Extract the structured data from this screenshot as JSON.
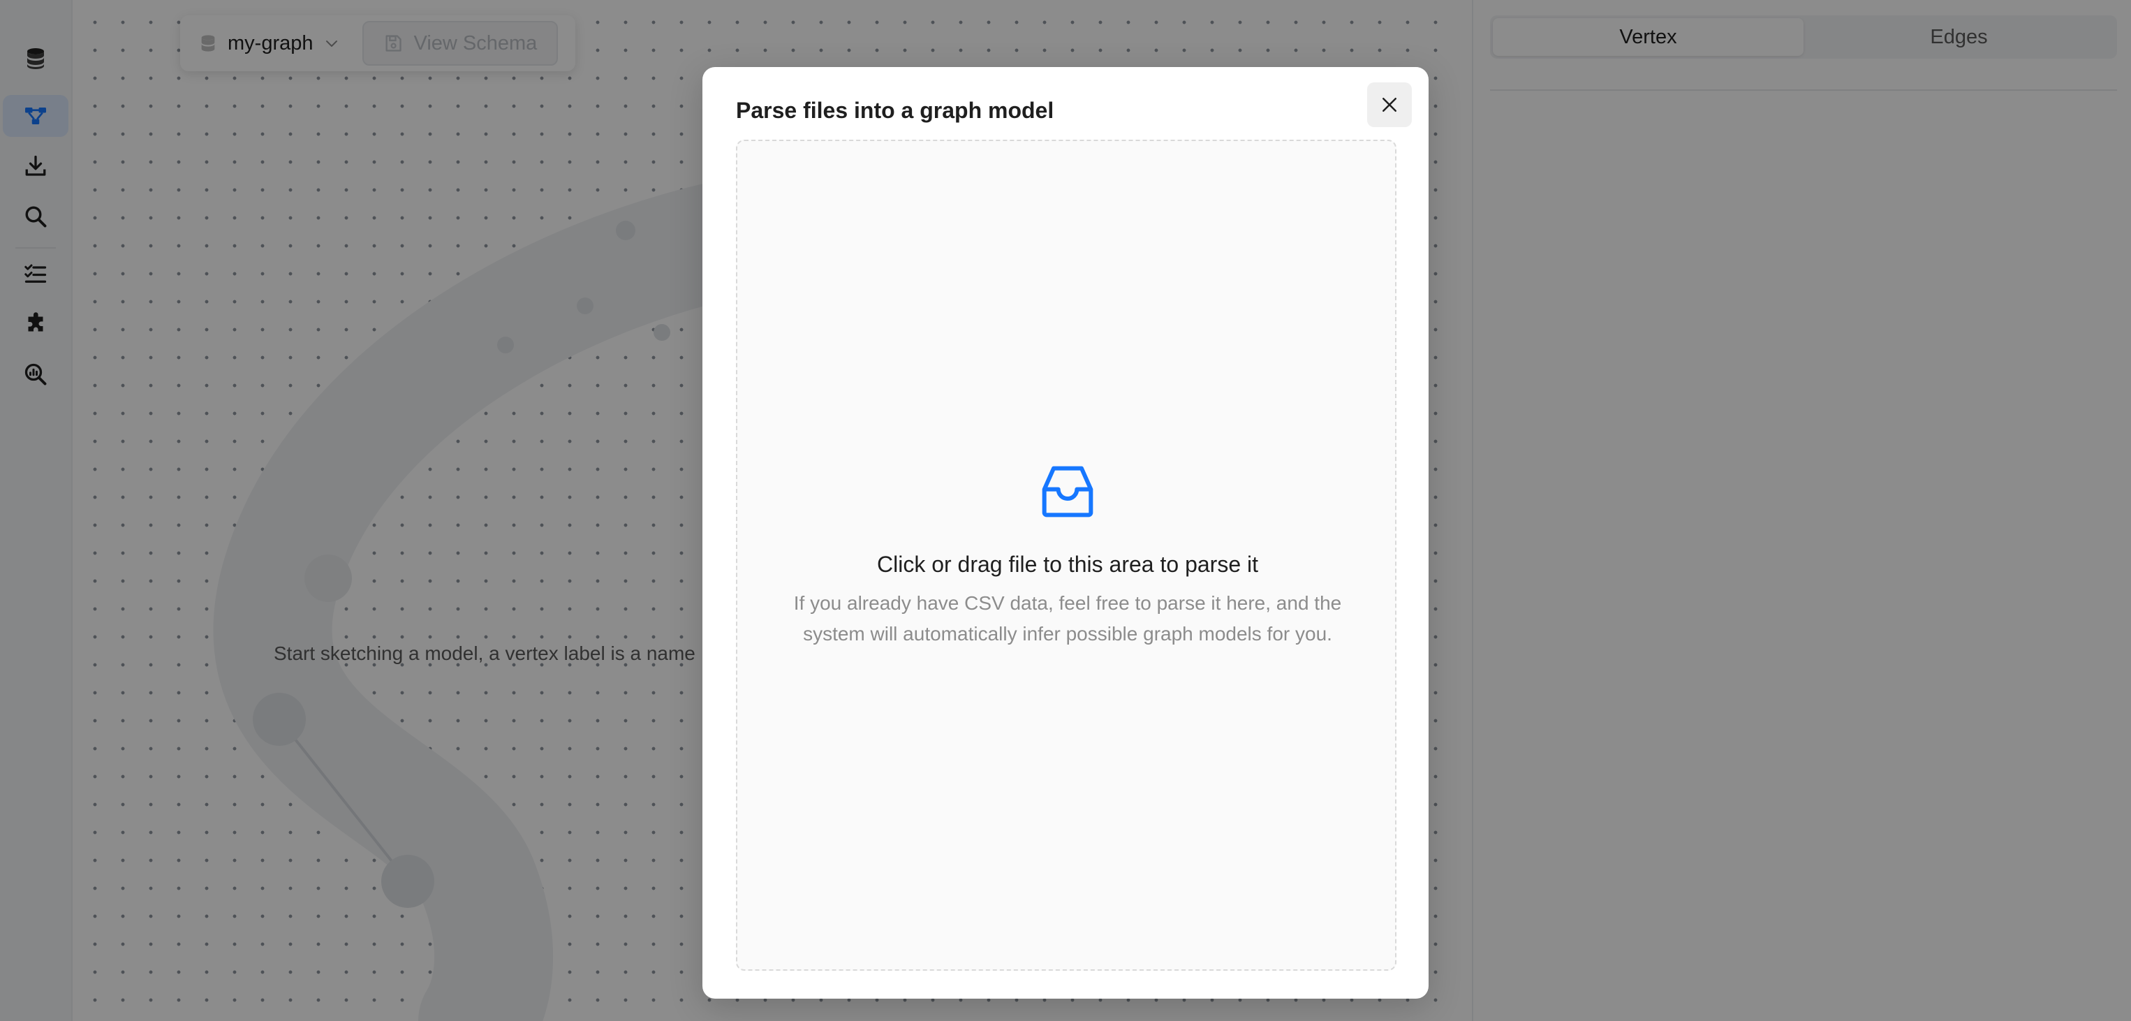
{
  "sidebar": {
    "items": [
      {
        "icon": "database-icon"
      },
      {
        "icon": "schema-graph-icon",
        "active": true
      },
      {
        "icon": "import-download-icon"
      },
      {
        "icon": "search-icon"
      },
      {
        "icon": "task-list-icon"
      },
      {
        "icon": "extension-puzzle-icon"
      },
      {
        "icon": "analysis-search-icon"
      }
    ]
  },
  "toolbar": {
    "graph_name": "my-graph",
    "view_schema_label": "View Schema"
  },
  "canvas": {
    "hint": "Start sketching a model, a vertex label is a name"
  },
  "right_panel": {
    "tabs": [
      "Vertex",
      "Edges"
    ],
    "active_tab": "Vertex"
  },
  "modal": {
    "title": "Parse files into a graph model",
    "dropzone": {
      "title": "Click or drag file to this area to parse it",
      "description": "If you already have CSV data, feel free to parse it here, and the system will automatically infer possible graph models for you."
    }
  },
  "colors": {
    "accent": "#1677ff",
    "mask": "rgba(0,0,0,0.45)",
    "active_nav_bg": "#dbe7fb"
  }
}
